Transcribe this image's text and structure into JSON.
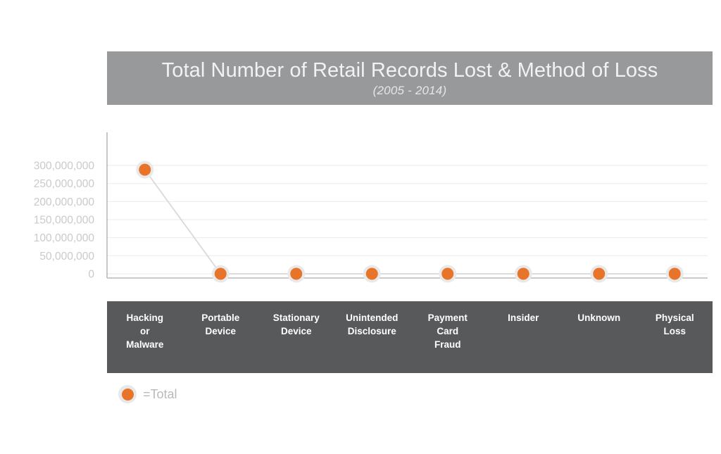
{
  "header": {
    "title": "Total Number of Retail Records Lost & Method of Loss",
    "subtitle": "(2005 - 2014)",
    "bar_color": "#97999b"
  },
  "legend": {
    "label": "=Total",
    "marker_color": "#e8742a",
    "marker_ring_color": "#e8e8e8",
    "position": "bottom-left"
  },
  "axis": {
    "category_bar_color": "#58595b",
    "tick_label_color": "#c9cacb",
    "gridline_color": "#f0f0f0",
    "axis_line_color": "#b8b9ba"
  },
  "chart_data": {
    "type": "line",
    "title": "Total Number of Retail Records Lost & Method of Loss",
    "subtitle": "(2005 - 2014)",
    "xlabel": "",
    "ylabel": "",
    "grid": true,
    "legend_position": "bottom-left",
    "ylim": [
      0,
      300000000
    ],
    "ytick_labels": [
      "300,000,000",
      "250,000,000",
      "200,000,000",
      "150,000,000",
      "100,000,000",
      "50,000,000",
      "0"
    ],
    "ytick_values": [
      300000000,
      250000000,
      200000000,
      150000000,
      100000000,
      50000000,
      0
    ],
    "categories": [
      "Hacking or Malware",
      "Portable Device",
      "Stationary Device",
      "Unintended Disclosure",
      "Payment Card Fraud",
      "Insider",
      "Unknown",
      "Physical Loss"
    ],
    "category_lines": [
      [
        "Hacking",
        "or",
        "Malware"
      ],
      [
        "Portable",
        "Device"
      ],
      [
        "Stationary",
        "Device"
      ],
      [
        "Unintended",
        "Disclosure"
      ],
      [
        "Payment",
        "Card",
        "Fraud"
      ],
      [
        "Insider"
      ],
      [
        "Unknown"
      ],
      [
        "Physical",
        "Loss"
      ]
    ],
    "series": [
      {
        "name": "Total",
        "color": "#e8742a",
        "values": [
          288000000,
          0,
          0,
          0,
          0,
          0,
          0,
          0
        ]
      }
    ]
  }
}
